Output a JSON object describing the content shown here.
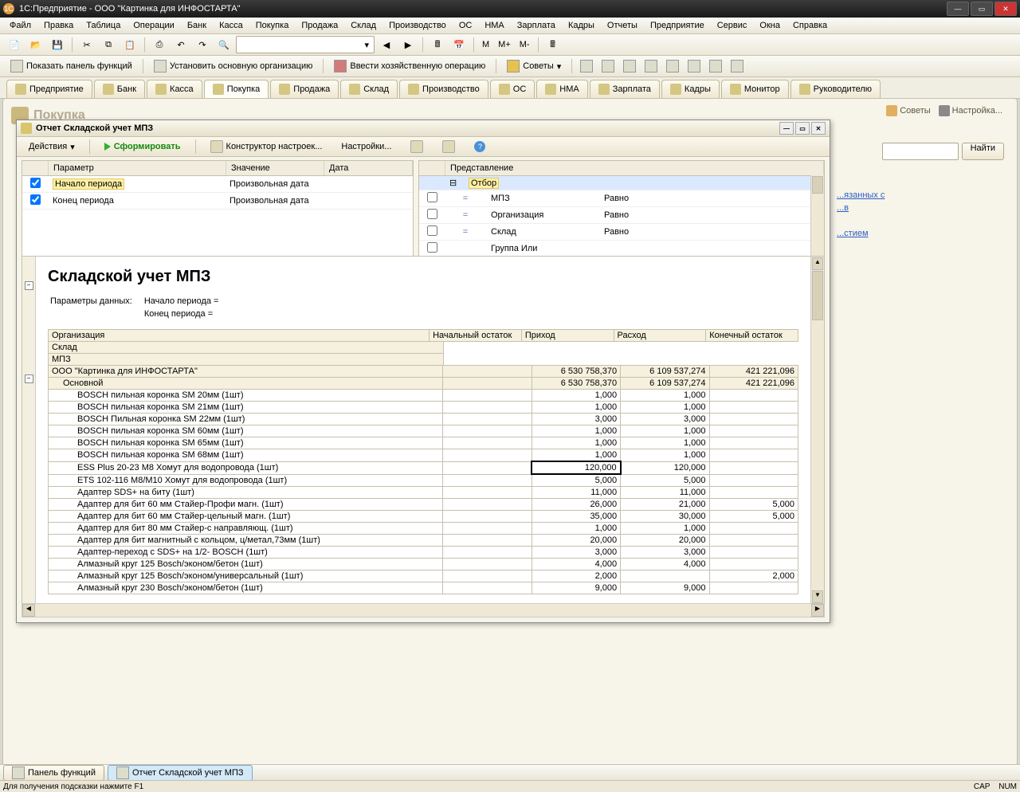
{
  "titlebar": {
    "app": "1С:Предприятие - ООО \"Картинка для ИНФОСТАРТА\""
  },
  "menu": [
    "Файл",
    "Правка",
    "Таблица",
    "Операции",
    "Банк",
    "Касса",
    "Покупка",
    "Продажа",
    "Склад",
    "Производство",
    "ОС",
    "НМА",
    "Зарплата",
    "Кадры",
    "Отчеты",
    "Предприятие",
    "Сервис",
    "Окна",
    "Справка"
  ],
  "toolbar2": {
    "show_panel": "Показать панель функций",
    "set_org": "Установить основную организацию",
    "enter_op": "Ввести хозяйственную операцию",
    "advices": "Советы"
  },
  "tabs": [
    {
      "label": "Предприятие"
    },
    {
      "label": "Банк"
    },
    {
      "label": "Касса"
    },
    {
      "label": "Покупка",
      "active": true
    },
    {
      "label": "Продажа"
    },
    {
      "label": "Склад"
    },
    {
      "label": "Производство"
    },
    {
      "label": "ОС"
    },
    {
      "label": "НМА"
    },
    {
      "label": "Зарплата"
    },
    {
      "label": "Кадры"
    },
    {
      "label": "Монитор"
    },
    {
      "label": "Руководителю"
    }
  ],
  "work_title": "Покупка",
  "rightlinks": {
    "advices": "Советы",
    "settings": "Настройка..."
  },
  "search": {
    "btn": "Найти"
  },
  "sidelinks": [
    "...язанных с",
    "...в",
    "...стием"
  ],
  "ml": {
    "m": "M",
    "mp": "M+",
    "mm": "M-"
  },
  "report_window": {
    "title": "Отчет  Складской учет МПЗ",
    "toolbar": {
      "actions": "Действия",
      "run": "Сформировать",
      "constructor": "Конструктор настроек...",
      "settings": "Настройки..."
    },
    "param_headers": {
      "param": "Параметр",
      "value": "Значение",
      "date": "Дата"
    },
    "params": [
      {
        "label": "Начало периода",
        "value": "Произвольная дата",
        "checked": true,
        "sel": true
      },
      {
        "label": "Конец периода",
        "value": "Произвольная дата",
        "checked": true
      }
    ],
    "filter_header": "Представление",
    "filter_root": "Отбор",
    "filters": [
      {
        "label": "МПЗ",
        "op": "Равно"
      },
      {
        "label": "Организация",
        "op": "Равно"
      },
      {
        "label": "Склад",
        "op": "Равно"
      },
      {
        "label": "Группа Или",
        "op": ""
      }
    ]
  },
  "report": {
    "title": "Складской учет МПЗ",
    "params_label": "Параметры данных:",
    "period_start": "Начало периода =",
    "period_end": "Конец периода =",
    "columns": {
      "org": "Организация",
      "sklad": "Склад",
      "mpz": "МПЗ",
      "start": "Начальный остаток",
      "in": "Приход",
      "out": "Расход",
      "end": "Конечный остаток"
    },
    "org_name": "ООО \"Картинка для ИНФОСТАРТА\"",
    "sklad_name": "Основной",
    "org_totals": {
      "in": "6 530 758,370",
      "out": "6 109 537,274",
      "end": "421 221,096"
    },
    "sklad_totals": {
      "in": "6 530 758,370",
      "out": "6 109 537,274",
      "end": "421 221,096"
    },
    "rows": [
      {
        "name": "BOSCH пильная коронка SM 20мм (1шт)",
        "in": "1,000",
        "out": "1,000",
        "end": ""
      },
      {
        "name": "BOSCH пильная коронка SM 21мм (1шт)",
        "in": "1,000",
        "out": "1,000",
        "end": ""
      },
      {
        "name": "BOSCH Пильная коронка SM 22мм (1шт)",
        "in": "3,000",
        "out": "3,000",
        "end": ""
      },
      {
        "name": "BOSCH пильная коронка SM 60мм (1шт)",
        "in": "1,000",
        "out": "1,000",
        "end": ""
      },
      {
        "name": "BOSCH пильная коронка SM 65мм (1шт)",
        "in": "1,000",
        "out": "1,000",
        "end": ""
      },
      {
        "name": "BOSCH пильная коронка SM 68мм (1шт)",
        "in": "1,000",
        "out": "1,000",
        "end": ""
      },
      {
        "name": "ESS Plus 20-23 М8 Хомут для водопровода    (1шт)",
        "in": "120,000",
        "out": "120,000",
        "end": "",
        "sel": true
      },
      {
        "name": "ETS 102-116 М8/М10  Хомут для водопровода    (1шт)",
        "in": "5,000",
        "out": "5,000",
        "end": ""
      },
      {
        "name": "Адаптер SDS+ на биту       (1шт)",
        "in": "11,000",
        "out": "11,000",
        "end": ""
      },
      {
        "name": "Адаптер для бит 60 мм Стайер-Профи магн.   (1шт)",
        "in": "26,000",
        "out": "21,000",
        "end": "5,000"
      },
      {
        "name": "Адаптер для бит 60 мм Стайер-цельный магн.  (1шт)",
        "in": "35,000",
        "out": "30,000",
        "end": "5,000"
      },
      {
        "name": "Адаптер для бит 80 мм Стайер-с направляющ.  (1шт)",
        "in": "1,000",
        "out": "1,000",
        "end": ""
      },
      {
        "name": "Адаптер для бит магнитный с кольцом, ц/метал,73мм (1шт)",
        "in": "20,000",
        "out": "20,000",
        "end": ""
      },
      {
        "name": "Адаптер-переход с SDS+ на 1/2- BOSCH       (1шт)",
        "in": "3,000",
        "out": "3,000",
        "end": ""
      },
      {
        "name": "Алмазный круг 125 Bosch/эконом/бетон (1шт)",
        "in": "4,000",
        "out": "4,000",
        "end": ""
      },
      {
        "name": "Алмазный круг 125 Bosch/эконом/универсальный (1шт)",
        "in": "2,000",
        "out": "",
        "end": "2,000"
      },
      {
        "name": "Алмазный круг 230 Bosch/эконом/бетон (1шт)",
        "in": "9,000",
        "out": "9,000",
        "end": ""
      }
    ]
  },
  "taskbar": {
    "item1": "Панель функций",
    "item2": "Отчет  Складской учет МПЗ"
  },
  "status": {
    "hint": "Для получения подсказки нажмите F1",
    "cap": "CAP",
    "num": "NUM"
  }
}
